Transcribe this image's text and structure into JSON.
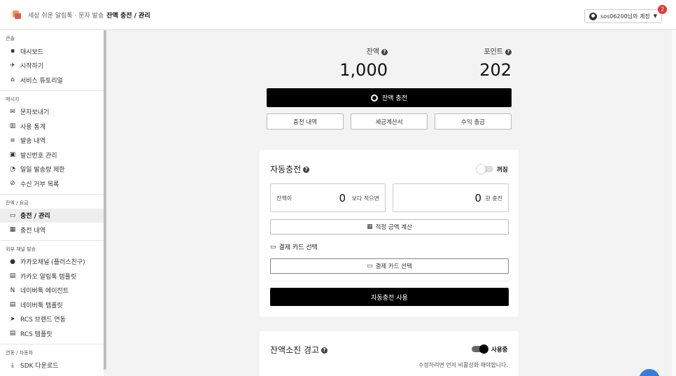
{
  "header": {
    "brand": "세상 쉬운 알림톡 · 문자 발송",
    "current_page": "잔액 충전 / 관리",
    "account": "sos06200님의 계정",
    "notification_count": "2"
  },
  "sidebar": {
    "sections": [
      {
        "title": "콘솔",
        "items": [
          {
            "icon": "dashboard-icon",
            "glyph": "▪",
            "label": "대시보드"
          },
          {
            "icon": "takeoff-icon",
            "glyph": "✈",
            "label": "시작하기"
          },
          {
            "icon": "graduation-icon",
            "glyph": "⌂",
            "label": "서비스 튜토리얼"
          }
        ]
      },
      {
        "title": "메시지",
        "items": [
          {
            "icon": "mail-icon",
            "glyph": "✉",
            "label": "문자보내기"
          },
          {
            "icon": "stats-icon",
            "glyph": "▥",
            "label": "사용 통계"
          },
          {
            "icon": "list-icon",
            "glyph": "≡",
            "label": "발송 내역"
          },
          {
            "icon": "id-card-icon",
            "glyph": "▣",
            "label": "발신번호 관리"
          },
          {
            "icon": "gauge-icon",
            "glyph": "◔",
            "label": "일일 발송량 제한"
          },
          {
            "icon": "block-icon",
            "glyph": "⊘",
            "label": "수신 거부 목록"
          }
        ]
      },
      {
        "title": "잔액 / 요금",
        "items": [
          {
            "icon": "card-icon",
            "glyph": "▭",
            "label": "충전 / 관리",
            "active": true
          },
          {
            "icon": "calendar-icon",
            "glyph": "▦",
            "label": "충전 내역"
          }
        ]
      },
      {
        "title": "외부 채널 발송",
        "items": [
          {
            "icon": "kakao-icon",
            "glyph": "●",
            "label": "카카오채널 (플러스친구)"
          },
          {
            "icon": "clipboard-icon",
            "glyph": "▤",
            "label": "카카오 알림톡 템플릿"
          },
          {
            "icon": "naver-icon",
            "glyph": "N",
            "label": "네이버톡 에이전트"
          },
          {
            "icon": "clipboard-icon",
            "glyph": "▤",
            "label": "네이버톡 템플릿"
          },
          {
            "icon": "send-icon",
            "glyph": "➤",
            "label": "RCS 브랜드 연동"
          },
          {
            "icon": "clipboard-icon",
            "glyph": "▤",
            "label": "RCS 템플릿"
          }
        ]
      },
      {
        "title": "연동 / 자동화",
        "items": [
          {
            "icon": "download-icon",
            "glyph": "⤓",
            "label": "SDK 다운로드"
          }
        ]
      }
    ]
  },
  "balance": {
    "balance_label": "잔액",
    "balance_value": "1,000",
    "point_label": "포인트",
    "point_value": "202",
    "charge_button": "잔액 충전",
    "history_button": "충전 내역",
    "invoice_button": "세금계산서",
    "withdraw_button": "수익 출금"
  },
  "auto_charge": {
    "title": "자동충전",
    "toggle_state": "꺼짐",
    "threshold_prefix": "잔액이",
    "threshold_value": "0",
    "threshold_suffix": "보다 적으면",
    "amount_value": "0",
    "amount_suffix": "원 충전",
    "calc_button": "적정 금액 계산",
    "card_label": "결제 카드 선택",
    "card_button": "결제 카드 선택",
    "use_button": "자동충전 사용"
  },
  "low_balance": {
    "title": "잔액소진 경고",
    "toggle_state": "사용중",
    "hint": "수정하려면 먼저 비활성화 해야합니다."
  },
  "colors": {
    "accent_black": "#000000",
    "badge_red": "#e53935",
    "chat_blue": "#3d7be0"
  }
}
